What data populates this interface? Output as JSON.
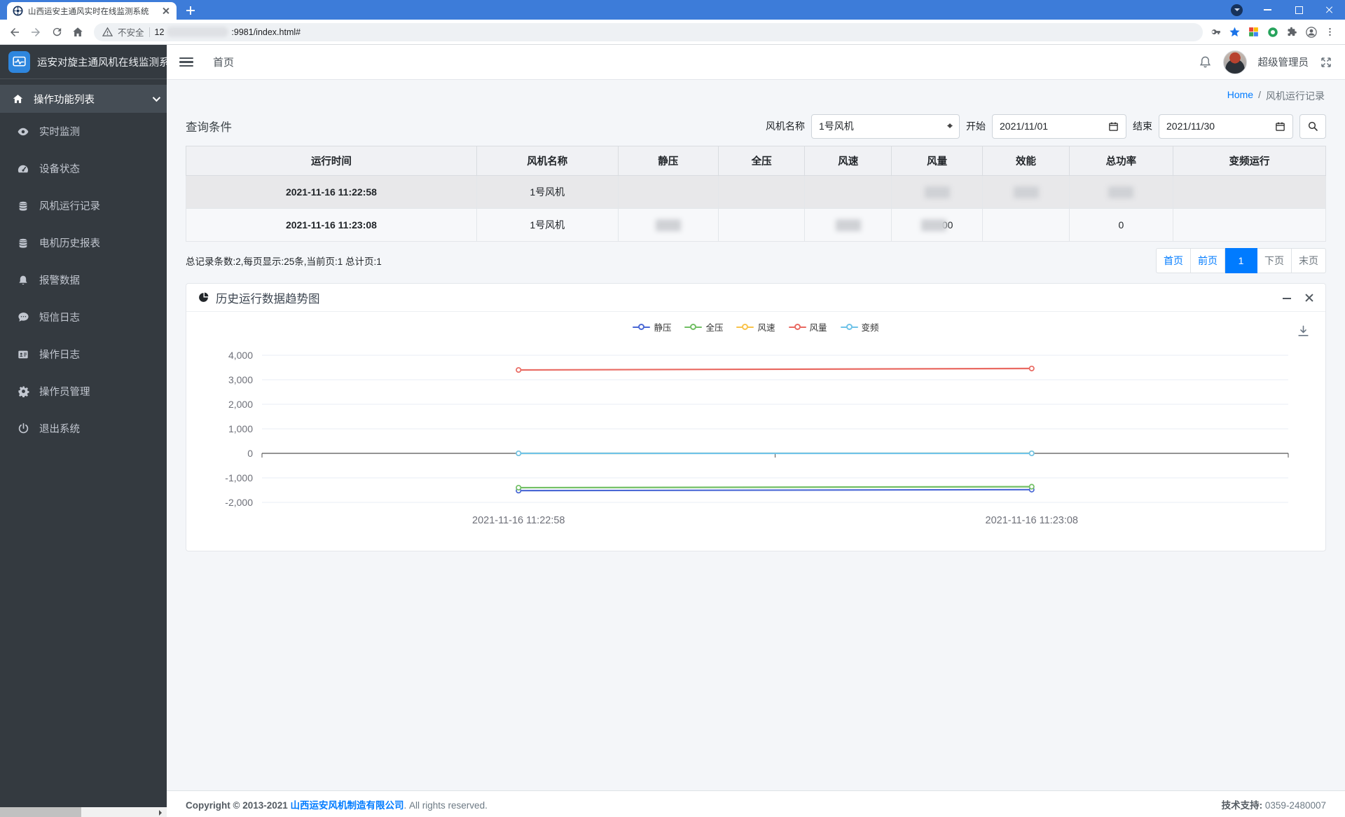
{
  "browser": {
    "tab_title": "山西运安主通风实时在线监测系统",
    "security_label": "不安全",
    "url_prefix": "12",
    "url_suffix": ":9981/index.html#"
  },
  "sidebar": {
    "brand": "运安对旋主通风机在线监测系统",
    "items": [
      {
        "label": "操作功能列表",
        "icon": "home",
        "active": true
      },
      {
        "label": "实时监测",
        "icon": "eye"
      },
      {
        "label": "设备状态",
        "icon": "gauge"
      },
      {
        "label": "风机运行记录",
        "icon": "database"
      },
      {
        "label": "电机历史报表",
        "icon": "database"
      },
      {
        "label": "报警数据",
        "icon": "bell"
      },
      {
        "label": "短信日志",
        "icon": "comment"
      },
      {
        "label": "操作日志",
        "icon": "id-card"
      },
      {
        "label": "操作员管理",
        "icon": "gear"
      },
      {
        "label": "退出系统",
        "icon": "power"
      }
    ]
  },
  "topnav": {
    "home_link": "首页",
    "user_name": "超级管理员"
  },
  "breadcrumb": {
    "home": "Home",
    "separator": "/",
    "current": "风机运行记录"
  },
  "query": {
    "title": "查询条件",
    "fan_label": "风机名称",
    "fan_value": "1号风机",
    "start_label": "开始",
    "start_value": "2021/11/01",
    "end_label": "结束",
    "end_value": "2021/11/30"
  },
  "table": {
    "headers": [
      "运行时间",
      "风机名称",
      "静压",
      "全压",
      "风速",
      "风量",
      "效能",
      "总功率",
      "变频运行"
    ],
    "rows": [
      {
        "cells": [
          {
            "text": "2021-11-16 11:22:58",
            "bold": true
          },
          {
            "text": "1号风机"
          },
          {},
          {},
          {},
          {
            "redacted": true
          },
          {
            "redacted": true
          },
          {
            "redacted": true
          },
          {}
        ]
      },
      {
        "cells": [
          {
            "text": "2021-11-16 11:23:08",
            "bold": true
          },
          {
            "text": "1号风机"
          },
          {
            "redacted": true
          },
          {},
          {
            "redacted": true
          },
          {
            "redacted": true,
            "suffix": "00"
          },
          {},
          {
            "text": "0"
          },
          {}
        ]
      }
    ],
    "summary": "总记录条数:2,每页显示:25条,当前页:1 总计页:1"
  },
  "pagination": {
    "buttons": [
      {
        "label": "首页",
        "state": "link"
      },
      {
        "label": "前页",
        "state": "link"
      },
      {
        "label": "1",
        "state": "active"
      },
      {
        "label": "下页",
        "state": "disabled"
      },
      {
        "label": "末页",
        "state": "disabled"
      }
    ]
  },
  "chart_panel": {
    "title": "历史运行数据趋势图"
  },
  "chart_data": {
    "type": "line",
    "x": [
      "2021-11-16 11:22:58",
      "2021-11-16 11:23:08"
    ],
    "series": [
      {
        "name": "静压",
        "color": "#4a68d5",
        "values": [
          -1520,
          -1480
        ]
      },
      {
        "name": "全压",
        "color": "#71bf63",
        "values": [
          -1400,
          -1360
        ]
      },
      {
        "name": "风速",
        "color": "#f9c34b",
        "values": [
          0,
          3
        ]
      },
      {
        "name": "风量",
        "color": "#e96a62",
        "values": [
          3400,
          3460
        ]
      },
      {
        "name": "变频",
        "color": "#6fc3e8",
        "values": [
          0,
          0
        ]
      }
    ],
    "ylim": [
      -2000,
      4000
    ],
    "yticks": [
      4000,
      3000,
      2000,
      1000,
      0,
      -1000,
      -2000
    ],
    "grid": true,
    "legend_position": "top",
    "title": "历史运行数据趋势图",
    "xlabel": "",
    "ylabel": ""
  },
  "footer": {
    "copyright_prefix": "Copyright © 2013-2021",
    "company": "山西运安风机制造有限公司",
    "copyright_suffix": ". All rights reserved.",
    "support_label": "技术支持:",
    "support_value": "0359-2480007"
  },
  "colors": {
    "accent_blue": "#007bff",
    "chrome_blue": "#3d7cd9",
    "sidebar_bg": "#343a40",
    "content_bg": "#f4f6f9",
    "bookmark_star": "#1a73e8"
  }
}
